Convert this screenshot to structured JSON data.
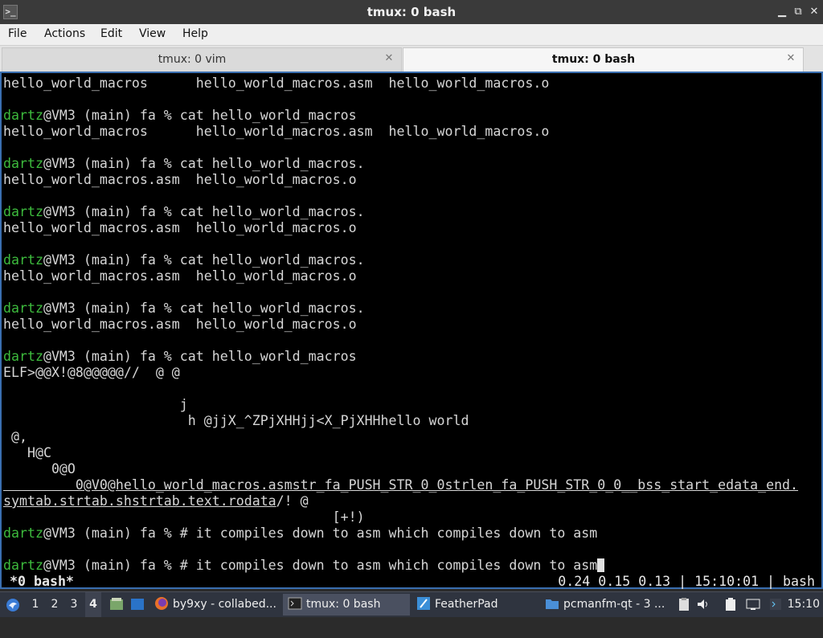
{
  "window": {
    "title": "tmux: 0 bash",
    "minimize_icon": "minimize-icon",
    "restore_icon": "restore-icon",
    "close_icon": "close-icon"
  },
  "menu": [
    "File",
    "Actions",
    "Edit",
    "View",
    "Help"
  ],
  "tabs": [
    {
      "label": "tmux: 0 vim",
      "active": false
    },
    {
      "label": "tmux: 0 bash",
      "active": true
    }
  ],
  "terminal": {
    "prompt_user": "dartz",
    "lines": [
      {
        "prompt": "",
        "text": "hello_world_macros      hello_world_macros.asm  hello_world_macros.o"
      },
      {
        "prompt": "",
        "text": ""
      },
      {
        "prompt": "dartz",
        "text": "@VM3 (main) fa % cat hello_world_macros"
      },
      {
        "prompt": "",
        "text": "hello_world_macros      hello_world_macros.asm  hello_world_macros.o"
      },
      {
        "prompt": "",
        "text": ""
      },
      {
        "prompt": "dartz",
        "text": "@VM3 (main) fa % cat hello_world_macros."
      },
      {
        "prompt": "",
        "text": "hello_world_macros.asm  hello_world_macros.o"
      },
      {
        "prompt": "",
        "text": ""
      },
      {
        "prompt": "dartz",
        "text": "@VM3 (main) fa % cat hello_world_macros."
      },
      {
        "prompt": "",
        "text": "hello_world_macros.asm  hello_world_macros.o"
      },
      {
        "prompt": "",
        "text": ""
      },
      {
        "prompt": "dartz",
        "text": "@VM3 (main) fa % cat hello_world_macros."
      },
      {
        "prompt": "",
        "text": "hello_world_macros.asm  hello_world_macros.o"
      },
      {
        "prompt": "",
        "text": ""
      },
      {
        "prompt": "dartz",
        "text": "@VM3 (main) fa % cat hello_world_macros."
      },
      {
        "prompt": "",
        "text": "hello_world_macros.asm  hello_world_macros.o"
      },
      {
        "prompt": "",
        "text": ""
      },
      {
        "prompt": "dartz",
        "text": "@VM3 (main) fa % cat hello_world_macros"
      },
      {
        "prompt": "",
        "text": "ELF>@@X!@8@@@@@//  @ @"
      },
      {
        "prompt": "",
        "text": ""
      },
      {
        "prompt": "",
        "text": "                      j"
      },
      {
        "prompt": "",
        "text": "                       h @jjX_^ZPjXHHjj<X_PjXHHhello world"
      },
      {
        "prompt": "",
        "text": " @,"
      },
      {
        "prompt": "",
        "text": "   H@C"
      },
      {
        "prompt": "",
        "text": "      0@O"
      },
      {
        "prompt": "",
        "text": "         0@V0@hello_world_macros.asmstr_fa_PUSH_STR_0_0strlen_fa_PUSH_STR_0_0__bss_start_edata_end.",
        "underline": true
      },
      {
        "prompt": "",
        "text": "symtab.strtab.shstrtab.text.rodata",
        "underline": true,
        "tail": "/! @"
      },
      {
        "prompt": "",
        "text": "                                         [+!)"
      },
      {
        "prompt": "dartz",
        "text": "@VM3 (main) fa % # it compiles down to asm which compiles down to asm"
      },
      {
        "prompt": "",
        "text": ""
      },
      {
        "prompt": "dartz",
        "text": "@VM3 (main) fa % # it compiles down to asm which compiles down to asm",
        "cursor": true
      }
    ]
  },
  "tmux_status": {
    "left": "*0 bash*",
    "right": "0.24 0.15 0.13 | 15:10:01 | bash"
  },
  "taskbar": {
    "start_icon": "start-menu-icon",
    "workspaces": [
      "1",
      "2",
      "3",
      "4"
    ],
    "active_workspace": "4",
    "tasks": [
      {
        "label": "by9xy - collabed...",
        "icon": "firefox-icon"
      },
      {
        "label": "tmux: 0 bash",
        "icon": "terminal-icon",
        "active": true
      },
      {
        "label": "FeatherPad",
        "icon": "featherpad-icon"
      },
      {
        "label": "pcmanfm-qt - 3 ...",
        "icon": "folder-icon"
      }
    ],
    "tray_icons": [
      "clipboard-icon",
      "network-icon",
      "volume-icon",
      "battery-icon"
    ],
    "clock": "15:10"
  }
}
